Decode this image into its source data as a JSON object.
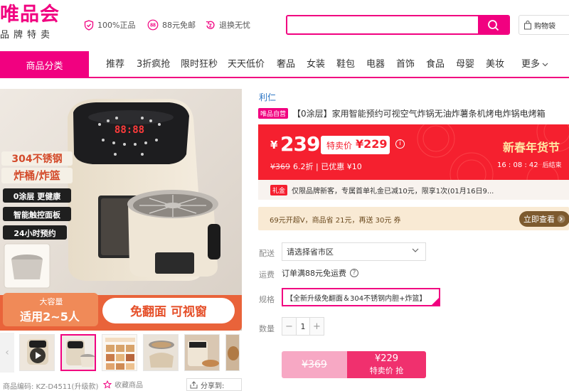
{
  "header": {
    "logo_main": "唯品会",
    "logo_sub": "品牌特卖",
    "promises": [
      "100%正品",
      "88元免邮",
      "退换无忧"
    ],
    "promise_badge": "88",
    "search_placeholder": "",
    "cart_label": "购物袋"
  },
  "nav": {
    "category_label": "商品分类",
    "items": [
      "推荐",
      "3折疯抢",
      "限时狂秒",
      "天天低价",
      "奢品",
      "女装",
      "鞋包",
      "电器",
      "首饰",
      "食品",
      "母婴",
      "美妆"
    ],
    "more_label": "更多"
  },
  "gallery": {
    "main_image": {
      "badge_material": "304不锈钢",
      "badge_parts": "炸桶/炸篮",
      "features": [
        "0涂层 更健康",
        "智能触控面板",
        "24小时预约"
      ],
      "capacity_label": "大容量",
      "capacity_value": "适用2~5人",
      "slogan": "免翻面 可视窗",
      "display_digits": "88:88"
    },
    "thumb_count": 6,
    "active_thumb": 1
  },
  "footer_info": {
    "product_code": "商品编码: KZ-D4511(升级款)",
    "favorite_label": "收藏商品",
    "share_label": "分享到:"
  },
  "product": {
    "brand": "利仁",
    "self_tag": "唯品自营",
    "title": "【0涂层】家用智能预约可视空气炸锅无油炸薯条机烤电炸锅电烤箱"
  },
  "price": {
    "currency": "¥",
    "value": "239",
    "special_label": "特卖价",
    "special_value": "¥229",
    "original": "¥369",
    "discount": "6.2折",
    "saved": "| 已优惠 ¥10",
    "festival": "新春年货节",
    "countdown": "16 : 08 : 42",
    "countdown_suffix": "后结束"
  },
  "gift": {
    "tag": "礼金",
    "text": "仅限品牌新客，专属首单礼金已减10元，限享1次(01月16日9..."
  },
  "vip": {
    "text": "69元开超V，商品省 21元，再送 30元 券",
    "button": "立即查看"
  },
  "delivery": {
    "label": "配送",
    "select_value": "请选择省市区"
  },
  "shipping": {
    "label": "运费",
    "text": "订单满88元免运费",
    "help": "?"
  },
  "spec": {
    "label": "规格",
    "option": "【全新升级免翻面＆304不锈钢内胆+炸篮】"
  },
  "quantity": {
    "label": "数量",
    "minus": "−",
    "value": "1",
    "plus": "+"
  },
  "buy": {
    "original_price": "¥369",
    "now_price": "¥229",
    "now_label": "特卖价 抢"
  },
  "colors": {
    "brand_pink": "#f10180",
    "price_red": "#f5202f",
    "vip_brown": "#7d5a2e",
    "link_blue": "#2d76c4"
  },
  "icons": [
    "shield-icon",
    "eighty-eight-icon",
    "return-icon",
    "search-icon",
    "bag-icon",
    "chevron-down-icon",
    "play-icon",
    "star-icon",
    "share-icon",
    "info-icon",
    "help-icon"
  ]
}
